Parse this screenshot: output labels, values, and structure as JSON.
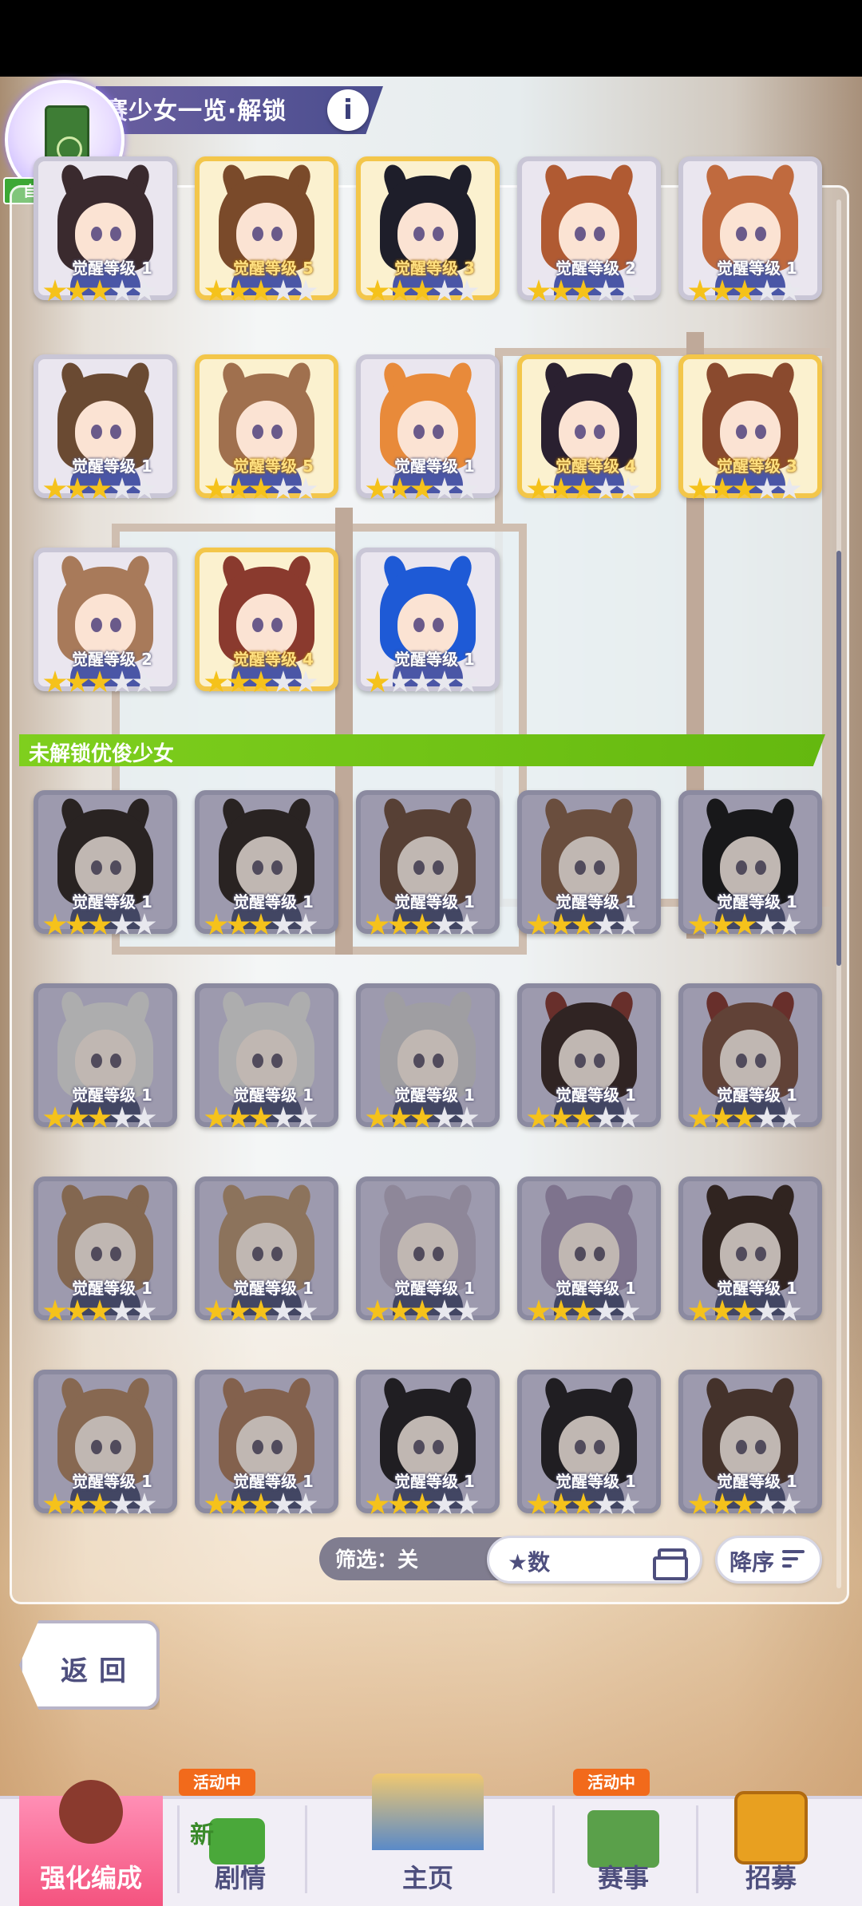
{
  "header": {
    "title": "赛少女一览·解锁",
    "info_glyph": "i"
  },
  "auto_train": {
    "label": "自动养成"
  },
  "section": {
    "locked_title": "未解锁优俊少女"
  },
  "cards": {
    "row0": [
      {
        "level": "觉醒等级 1",
        "stars": 3,
        "gold": false,
        "hair": "#3a2a2e",
        "ear": "#3a2a2e"
      },
      {
        "level": "觉醒等级 5",
        "stars": 3,
        "gold": true,
        "hair": "#7a4a2a",
        "ear": "#7a4a2a"
      },
      {
        "level": "觉醒等级 3",
        "stars": 3,
        "gold": true,
        "hair": "#1e1e2a",
        "ear": "#1e1e2a"
      },
      {
        "level": "觉醒等级 2",
        "stars": 3,
        "gold": false,
        "hair": "#b05a32",
        "ear": "#b05a32"
      },
      {
        "level": "觉醒等级 1",
        "stars": 3,
        "gold": false,
        "hair": "#c06a3e",
        "ear": "#c06a3e"
      }
    ],
    "row1": [
      {
        "level": "觉醒等级 1",
        "stars": 3,
        "gold": false,
        "hair": "#6a4a32",
        "ear": "#6a4a32"
      },
      {
        "level": "觉醒等级 5",
        "stars": 3,
        "gold": true,
        "hair": "#a0704e",
        "ear": "#a0704e"
      },
      {
        "level": "觉醒等级 1",
        "stars": 3,
        "gold": false,
        "hair": "#e88a3a",
        "ear": "#e88a3a"
      },
      {
        "level": "觉醒等级 4",
        "stars": 3,
        "gold": true,
        "hair": "#2a2030",
        "ear": "#2a2030"
      },
      {
        "level": "觉醒等级 3",
        "stars": 3,
        "gold": true,
        "hair": "#8a4a2e",
        "ear": "#8a4a2e"
      }
    ],
    "row2": [
      {
        "level": "觉醒等级 2",
        "stars": 3,
        "gold": false,
        "hair": "#a87a5a",
        "ear": "#a87a5a"
      },
      {
        "level": "觉醒等级 4",
        "stars": 3,
        "gold": true,
        "hair": "#8a3a2e",
        "ear": "#8a3a2e"
      },
      {
        "level": "觉醒等级 1",
        "stars": 1,
        "gold": false,
        "hair": "#1e5ad6",
        "ear": "#1e5ad6"
      }
    ],
    "row3": [
      {
        "level": "觉醒等级 1",
        "stars": 3,
        "gold": false,
        "hair": "#3a2a26",
        "ear": "#3a2a26"
      },
      {
        "level": "觉醒等级 1",
        "stars": 3,
        "gold": false,
        "hair": "#3a2a26",
        "ear": "#3a2a26"
      },
      {
        "level": "觉醒等级 1",
        "stars": 3,
        "gold": false,
        "hair": "#8a4a2a",
        "ear": "#8a4a2a"
      },
      {
        "level": "觉醒等级 1",
        "stars": 3,
        "gold": false,
        "hair": "#a85a2e",
        "ear": "#a85a2e"
      },
      {
        "level": "觉醒等级 1",
        "stars": 3,
        "gold": false,
        "hair": "#1e1e22",
        "ear": "#1e1e22"
      }
    ],
    "row4": [
      {
        "level": "觉醒等级 1",
        "stars": 3,
        "gold": false,
        "hair": "#d8d8dc",
        "ear": "#d8d8dc"
      },
      {
        "level": "觉醒等级 1",
        "stars": 3,
        "gold": false,
        "hair": "#d8d8dc",
        "ear": "#d8d8dc"
      },
      {
        "level": "觉醒等级 1",
        "stars": 3,
        "gold": false,
        "hair": "#c8c4d0",
        "ear": "#c8c4d0"
      },
      {
        "level": "觉醒等级 1",
        "stars": 3,
        "gold": false,
        "hair": "#4a2a26",
        "ear": "#c8281e"
      },
      {
        "level": "觉醒等级 1",
        "stars": 3,
        "gold": false,
        "hair": "#a04a2a",
        "ear": "#c8281e"
      }
    ],
    "row5": [
      {
        "level": "觉醒等级 1",
        "stars": 3,
        "gold": false,
        "hair": "#c87a3a",
        "ear": "#c87a3a"
      },
      {
        "level": "觉醒等级 1",
        "stars": 3,
        "gold": false,
        "hair": "#d08a4a",
        "ear": "#d08a4a"
      },
      {
        "level": "觉醒等级 1",
        "stars": 3,
        "gold": false,
        "hair": "#b8a4d8",
        "ear": "#b8a4d8"
      },
      {
        "level": "觉醒等级 1",
        "stars": 3,
        "gold": false,
        "hair": "#a88ad0",
        "ear": "#a88ad0"
      },
      {
        "level": "觉醒等级 1",
        "stars": 3,
        "gold": false,
        "hair": "#4a2a1e",
        "ear": "#4a2a1e"
      }
    ],
    "row6": [
      {
        "level": "觉醒等级 1",
        "stars": 3,
        "gold": false,
        "hair": "#d07a3a",
        "ear": "#d07a3a"
      },
      {
        "level": "觉醒等级 1",
        "stars": 3,
        "gold": false,
        "hair": "#d0703a",
        "ear": "#d0703a"
      },
      {
        "level": "觉醒等级 1",
        "stars": 3,
        "gold": false,
        "hair": "#2a2430",
        "ear": "#2a2430"
      },
      {
        "level": "觉醒等级 1",
        "stars": 3,
        "gold": false,
        "hair": "#2a2430",
        "ear": "#2a2430"
      },
      {
        "level": "觉醒等级 1",
        "stars": 3,
        "gold": false,
        "hair": "#6a3a26",
        "ear": "#6a3a26"
      }
    ]
  },
  "filter": {
    "label": "筛选：关",
    "sort_value": "★数",
    "order_label": "降序"
  },
  "back_button": {
    "label": "返回"
  },
  "bottom_nav": {
    "items": [
      {
        "label": "强化编成",
        "active": true,
        "badge": ""
      },
      {
        "label": "剧情",
        "active": false,
        "badge": "活动中"
      },
      {
        "label": "主页",
        "active": false,
        "badge": ""
      },
      {
        "label": "赛事",
        "active": false,
        "badge": "活动中"
      },
      {
        "label": "招募",
        "active": false,
        "badge": ""
      }
    ],
    "new_tag": "新"
  }
}
